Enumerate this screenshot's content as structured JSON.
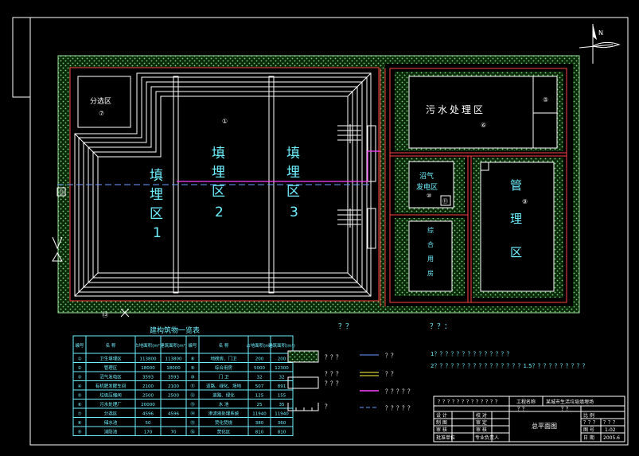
{
  "zones": {
    "fill1": {
      "chars": [
        "填",
        "埋",
        "区",
        "1"
      ]
    },
    "fill2": {
      "chars": [
        "填",
        "埋",
        "区",
        "2"
      ]
    },
    "fill3": {
      "chars": [
        "填",
        "埋",
        "区",
        "3"
      ]
    },
    "fill_num": "①",
    "sorting": {
      "label": "分选区",
      "num": "⑦"
    },
    "sewage": {
      "label": "污水处理区",
      "num_a": "⑥",
      "num_b": "⑤"
    },
    "biogas": {
      "line1": "沼气",
      "line2": "发电区",
      "num": "⑩",
      "num_b": "⑪"
    },
    "management": {
      "chars": [
        "管",
        "理",
        "区"
      ],
      "num": "⑨"
    },
    "dorm": {
      "chars": [
        "综",
        "合",
        "用",
        "房"
      ]
    },
    "gate_num": "⑫",
    "bottom_num": "⑬"
  },
  "table": {
    "title": "建构筑物一览表",
    "headers": [
      "编号",
      "名 称",
      "占地面积(m²)",
      "建筑面积(m²)",
      "编号",
      "名 称",
      "占地面积(m²)",
      "建筑面积(m²)"
    ],
    "rows": [
      [
        "①",
        "卫生填埋区",
        "113800",
        "113800",
        "⑧",
        "地磅房、门卫",
        "200",
        "200"
      ],
      [
        "②",
        "管理区",
        "18000",
        "18000",
        "⑨",
        "综合用房",
        "5000",
        "12300"
      ],
      [
        "③",
        "沼气发电区",
        "3593",
        "3593",
        "⑩",
        "门 卫",
        "32",
        "32"
      ],
      [
        "④",
        "有机肥发酵车间",
        "2100",
        "2100",
        "⑪",
        "道路、绿化、场地",
        "507",
        "891"
      ],
      [
        "⑤",
        "垃圾压缩间",
        "2500",
        "2500",
        "⑫",
        "道路、绿化",
        "125",
        "155"
      ],
      [
        "⑥",
        "污水处理厂",
        "20000",
        "",
        "⑬",
        "水 池",
        "25",
        "35"
      ],
      [
        "⑦",
        "分选区",
        "4596",
        "4596",
        "⑭",
        "渗滤液处理系统",
        "11940",
        "11940"
      ],
      [
        "⑧",
        "储水池",
        "50",
        "",
        "⑮",
        "焚化焚烧",
        "380",
        "360"
      ],
      [
        "⑨",
        "消防池",
        "170",
        "70",
        "⑯",
        "焚化区",
        "810",
        "810"
      ]
    ]
  },
  "legend": {
    "header_left": "？？",
    "header_right": "？？：",
    "items": [
      {
        "label": "？？？"
      },
      {
        "label": "？？？"
      },
      {
        "label": "？？？"
      },
      {
        "label": "？"
      },
      {
        "label": "？？"
      },
      {
        "label": "？？"
      },
      {
        "label": "？？？？？"
      },
      {
        "label": "？？？？？"
      }
    ],
    "note1": "1？？？？？？？？？？？？？？",
    "note2": "2？？？？？？？？？？？？？？？？1.5？？？？？？？？？？"
  },
  "titleblock": {
    "top_note": "？？？？？？？？？？？？？",
    "project_label": "工程名称",
    "project_value": "某城市生活垃圾填埋场",
    "q1": "？？",
    "q2": "？？",
    "rows_left": [
      "设 计",
      "制 图",
      "审 核",
      "批准单位"
    ],
    "rows_mid": [
      "校 对",
      "审 定",
      "审 核",
      "专业负责人"
    ],
    "drawing_title": "总平面图",
    "scale_label": "比 例",
    "scale_v1": "？？？",
    "scale_v2": "？？？",
    "sheet_label": "图 号",
    "sheet_value": "1-02",
    "date_label": "日 期",
    "date_value": "2005.6"
  },
  "north": {
    "label": "N"
  }
}
